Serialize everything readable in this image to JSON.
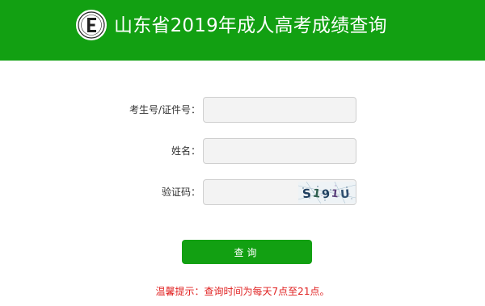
{
  "header": {
    "title": "山东省2019年成人高考成绩查询",
    "background_color": "#12a012",
    "logo_icon": "exam-authority-logo"
  },
  "form": {
    "candidate_id": {
      "label": "考生号/证件号：",
      "value": ""
    },
    "name": {
      "label": "姓名：",
      "value": ""
    },
    "captcha": {
      "label": "验证码：",
      "value": "",
      "image_text": "S1 9 1 U"
    },
    "submit_label": "查询"
  },
  "tip": "温馨提示：查询时间为每天7点至21点。",
  "colors": {
    "accent": "#12a012",
    "tip_text": "#e02020"
  }
}
